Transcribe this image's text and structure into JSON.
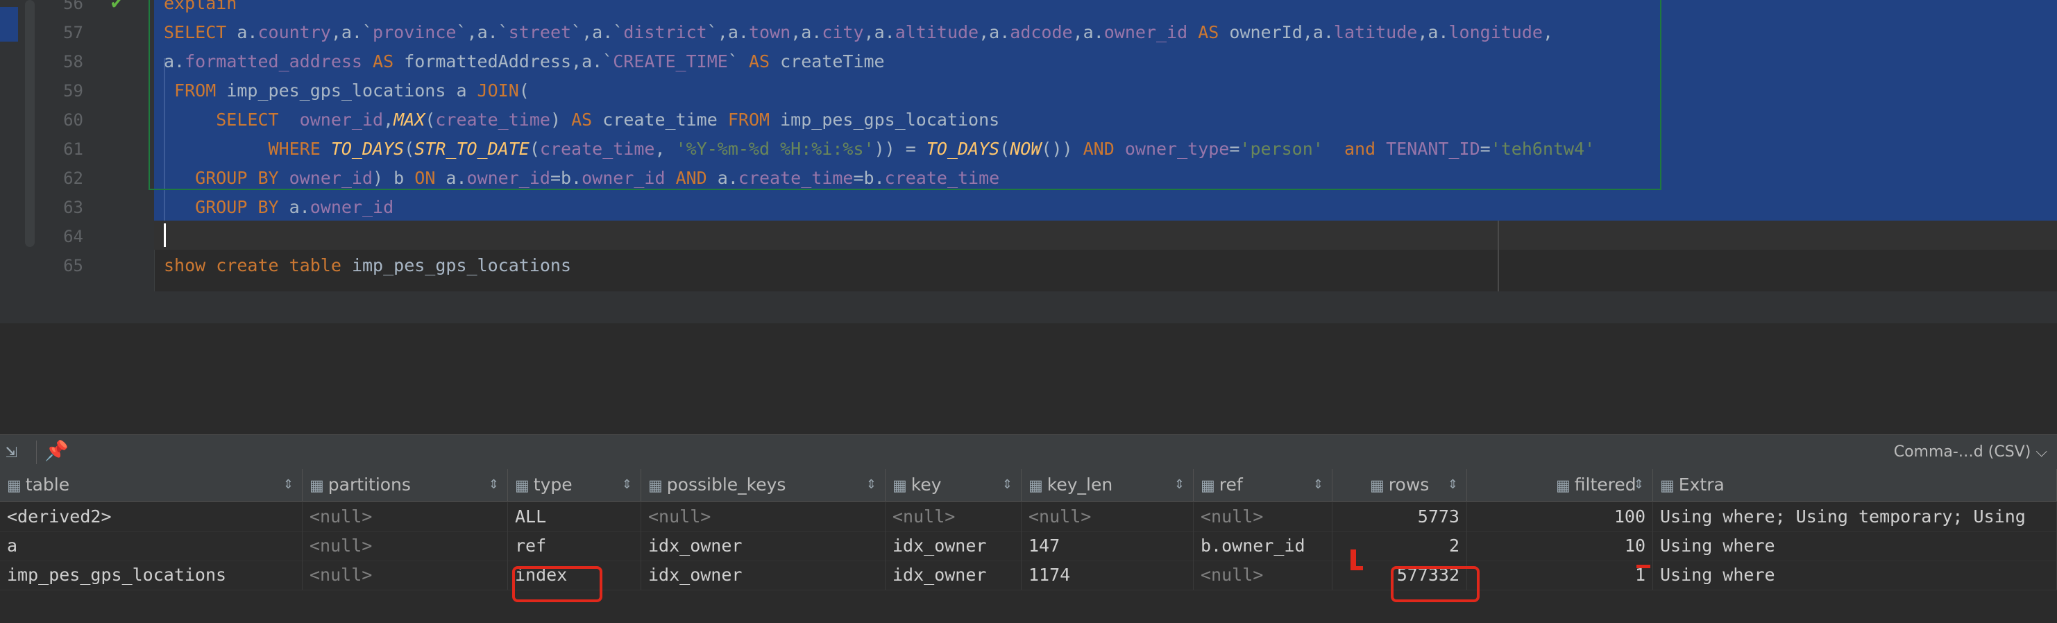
{
  "editor": {
    "line_numbers": [
      "56",
      "57",
      "58",
      "59",
      "60",
      "61",
      "62",
      "63",
      "64",
      "65"
    ],
    "lines": [
      [
        {
          "t": "explain",
          "c": "kw"
        }
      ],
      [
        {
          "t": "SELECT ",
          "c": "kw"
        },
        {
          "t": "a.",
          "c": ""
        },
        {
          "t": "country",
          "c": "fld"
        },
        {
          "t": ",a.`",
          "c": ""
        },
        {
          "t": "province",
          "c": "fld"
        },
        {
          "t": "`,a.`",
          "c": ""
        },
        {
          "t": "street",
          "c": "fld"
        },
        {
          "t": "`,a.`",
          "c": ""
        },
        {
          "t": "district",
          "c": "fld"
        },
        {
          "t": "`,a.",
          "c": ""
        },
        {
          "t": "town",
          "c": "fld"
        },
        {
          "t": ",a.",
          "c": ""
        },
        {
          "t": "city",
          "c": "fld"
        },
        {
          "t": ",a.",
          "c": ""
        },
        {
          "t": "altitude",
          "c": "fld"
        },
        {
          "t": ",a.",
          "c": ""
        },
        {
          "t": "adcode",
          "c": "fld"
        },
        {
          "t": ",a.",
          "c": ""
        },
        {
          "t": "owner_id",
          "c": "fld"
        },
        {
          "t": " AS ",
          "c": "kw"
        },
        {
          "t": "ownerId",
          "c": ""
        },
        {
          "t": ",a.",
          "c": ""
        },
        {
          "t": "latitude",
          "c": "fld"
        },
        {
          "t": ",a.",
          "c": ""
        },
        {
          "t": "longitude",
          "c": "fld"
        },
        {
          "t": ",",
          "c": ""
        }
      ],
      [
        {
          "t": "a.",
          "c": ""
        },
        {
          "t": "formatted_address",
          "c": "fld"
        },
        {
          "t": " AS ",
          "c": "kw"
        },
        {
          "t": "formattedAddress",
          "c": ""
        },
        {
          "t": ",a.`",
          "c": ""
        },
        {
          "t": "CREATE_TIME",
          "c": "fld"
        },
        {
          "t": "` ",
          "c": ""
        },
        {
          "t": "AS ",
          "c": "kw"
        },
        {
          "t": "createTime",
          "c": ""
        }
      ],
      [
        {
          "t": " FROM ",
          "c": "kw"
        },
        {
          "t": "imp_pes_gps_locations a ",
          "c": ""
        },
        {
          "t": "JOIN",
          "c": "kw"
        },
        {
          "t": "(",
          "c": ""
        }
      ],
      [
        {
          "t": "     SELECT  ",
          "c": "kw"
        },
        {
          "t": "owner_id",
          "c": "fld"
        },
        {
          "t": ",",
          "c": ""
        },
        {
          "t": "MAX",
          "c": "fn"
        },
        {
          "t": "(",
          "c": ""
        },
        {
          "t": "create_time",
          "c": "fld"
        },
        {
          "t": ") ",
          "c": ""
        },
        {
          "t": "AS ",
          "c": "kw"
        },
        {
          "t": "create_time ",
          "c": ""
        },
        {
          "t": "FROM ",
          "c": "kw"
        },
        {
          "t": "imp_pes_gps_locations",
          "c": ""
        }
      ],
      [
        {
          "t": "          WHERE ",
          "c": "kw"
        },
        {
          "t": "TO_DAYS",
          "c": "fn"
        },
        {
          "t": "(",
          "c": ""
        },
        {
          "t": "STR_TO_DATE",
          "c": "fn"
        },
        {
          "t": "(",
          "c": ""
        },
        {
          "t": "create_time",
          "c": "fld"
        },
        {
          "t": ", ",
          "c": ""
        },
        {
          "t": "'%Y-%m-%d %H:%i:%s'",
          "c": "str"
        },
        {
          "t": ")) = ",
          "c": ""
        },
        {
          "t": "TO_DAYS",
          "c": "fn"
        },
        {
          "t": "(",
          "c": ""
        },
        {
          "t": "NOW",
          "c": "fn"
        },
        {
          "t": "()) ",
          "c": ""
        },
        {
          "t": "AND ",
          "c": "kw"
        },
        {
          "t": "owner_type",
          "c": "fld"
        },
        {
          "t": "=",
          "c": ""
        },
        {
          "t": "'person'",
          "c": "str"
        },
        {
          "t": "  and ",
          "c": "kw"
        },
        {
          "t": "TENANT_ID",
          "c": "fld"
        },
        {
          "t": "=",
          "c": ""
        },
        {
          "t": "'teh6ntw4'",
          "c": "str"
        }
      ],
      [
        {
          "t": "   GROUP BY ",
          "c": "kw"
        },
        {
          "t": "owner_id",
          "c": "fld"
        },
        {
          "t": ") b ",
          "c": ""
        },
        {
          "t": "ON ",
          "c": "kw"
        },
        {
          "t": "a.",
          "c": ""
        },
        {
          "t": "owner_id",
          "c": "fld"
        },
        {
          "t": "=b.",
          "c": ""
        },
        {
          "t": "owner_id ",
          "c": "fld"
        },
        {
          "t": "AND ",
          "c": "kw"
        },
        {
          "t": "a.",
          "c": ""
        },
        {
          "t": "create_time",
          "c": "fld"
        },
        {
          "t": "=b.",
          "c": ""
        },
        {
          "t": "create_time",
          "c": "fld"
        }
      ],
      [
        {
          "t": "   GROUP BY ",
          "c": "kw"
        },
        {
          "t": "a.",
          "c": ""
        },
        {
          "t": "owner_id",
          "c": "fld"
        }
      ],
      [],
      [
        {
          "t": "show create table ",
          "c": "kw"
        },
        {
          "t": "imp_pes_gps_locations",
          "c": ""
        }
      ]
    ]
  },
  "toolbar": {
    "export_format": "Comma-…d (CSV)",
    "export_format_caret": "⌵"
  },
  "grid": {
    "columns": [
      "table",
      "partitions",
      "type",
      "possible_keys",
      "key",
      "key_len",
      "ref",
      "rows",
      "filtered",
      "Extra"
    ],
    "rows": [
      [
        "<derived2>",
        "<null>",
        "ALL",
        "<null>",
        "<null>",
        "<null>",
        "<null>",
        "5773",
        "100",
        "Using where; Using temporary; Using"
      ],
      [
        "a",
        "<null>",
        "ref",
        "idx_owner",
        "idx_owner",
        "147",
        "b.owner_id",
        "2",
        "10",
        "Using where"
      ],
      [
        "imp_pes_gps_locations",
        "<null>",
        "index",
        "idx_owner",
        "idx_owner",
        "1174",
        "<null>",
        "577332",
        "1",
        "Using where"
      ]
    ]
  },
  "colors": {
    "highlight_box": "#e0281b",
    "selection": "#214283"
  },
  "icons": [
    "check-icon",
    "sort-icon",
    "table-column-icon",
    "pin-icon",
    "layout-icon"
  ]
}
